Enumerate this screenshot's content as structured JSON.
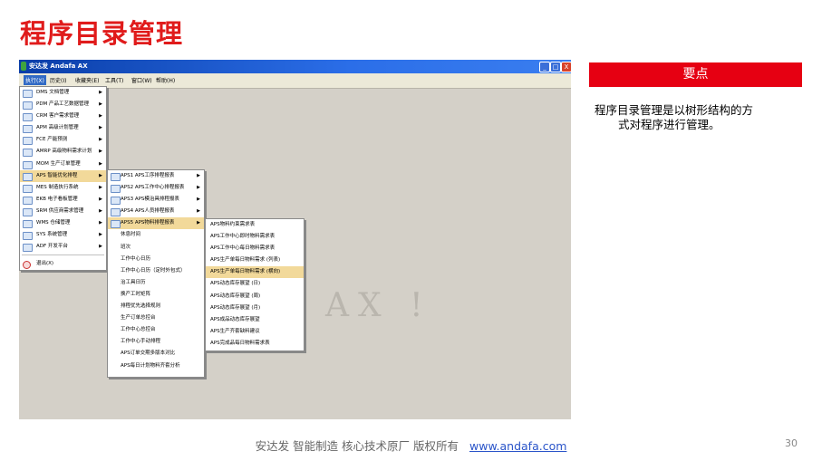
{
  "slide": {
    "title": "程序目录管理",
    "keypoint_label": "要点",
    "keypoint_text_line1": "程序目录管理是以树形结构的方",
    "keypoint_text_line2": "式对程序进行管理。",
    "footer_text": "安达发   智能制造 核心技术原厂    版权所有",
    "footer_link": "www.andafa.com",
    "page_number": "30"
  },
  "window": {
    "title": "安达发 Andafa AX",
    "buttons": [
      "_",
      "□",
      "X"
    ],
    "watermark": "AX !"
  },
  "menubar": [
    "执行(X)",
    "历史(I)",
    "收藏夹(E)",
    "工具(T)",
    "窗口(W)",
    "帮助(H)"
  ],
  "menu_main": [
    {
      "label": "DMS 文档管理",
      "submenu": true
    },
    {
      "label": "PDM 产品工艺数据管理",
      "submenu": true
    },
    {
      "label": "CRM 客户需求管理",
      "submenu": true
    },
    {
      "label": "APM 高级计划管理",
      "submenu": true
    },
    {
      "label": "FCE 产能预测",
      "submenu": true
    },
    {
      "label": "AMRP 高级物料需求计划",
      "submenu": true
    },
    {
      "label": "MOM 生产订单管理",
      "submenu": true
    },
    {
      "label": "APS 智能优化排程",
      "submenu": true,
      "active": true
    },
    {
      "label": "MES 制造执行系统",
      "submenu": true
    },
    {
      "label": "EKB 电子看板管理",
      "submenu": true
    },
    {
      "label": "SRM 供应商需求管理",
      "submenu": true
    },
    {
      "label": "WMS 仓储管理",
      "submenu": true
    },
    {
      "label": "SYS 系统管理",
      "submenu": true
    },
    {
      "label": "ADF 开发平台",
      "submenu": true
    }
  ],
  "menu_main_exit": "退出(X)",
  "menu_aps": [
    {
      "label": "APS1 APS工序排程报表",
      "submenu": true
    },
    {
      "label": "APS2 APS工作中心排程报表",
      "submenu": true
    },
    {
      "label": "APS3 APS模治具排程报表",
      "submenu": true
    },
    {
      "label": "APS4 APS人员排程报表",
      "submenu": true
    },
    {
      "label": "APS5 APS物料排程报表",
      "submenu": true,
      "active": true
    }
  ],
  "menu_aps_items": [
    "休息时间",
    "班次",
    "工作中心日历",
    "工作中心日历（定时外包式）",
    "治工具日历",
    "换产工时矩阵",
    "排程优先选择规则",
    "生产订单总控台",
    "工作中心总控台",
    "工作中心手动排程",
    "APS订单交期多版本对比",
    "APS每日计划物料齐套分析"
  ],
  "menu_aps5": [
    {
      "label": "APS物料约束需求表"
    },
    {
      "label": "APS工作中心即时物料需求表"
    },
    {
      "label": "APS工作中心每日物料需求表"
    },
    {
      "label": "APS生产单每日物料需求 (列表)"
    },
    {
      "label": "APS生产单每日物料需求 (横向)",
      "active": true
    },
    {
      "label": "APS动态库存展望 (日)"
    },
    {
      "label": "APS动态库存展望 (周)"
    },
    {
      "label": "APS动态库存展望 (月)"
    },
    {
      "label": "APS成品动态库存展望"
    },
    {
      "label": "APS生产齐套缺料建议"
    },
    {
      "label": "APS完成品每日物料需求表"
    }
  ]
}
